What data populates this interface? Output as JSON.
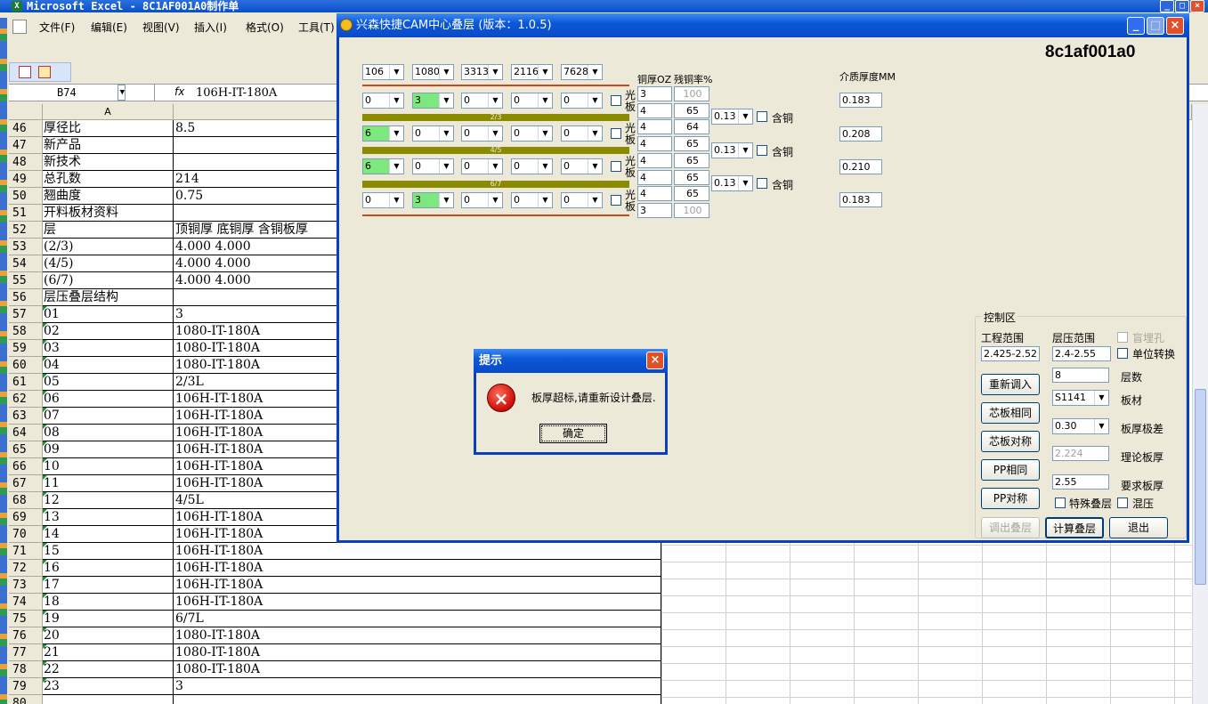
{
  "excel": {
    "title": "Microsoft Excel - 8C1AF001A0制作单",
    "menu": [
      "文件(F)",
      "编辑(E)",
      "视图(V)",
      "插入(I)",
      "格式(O)",
      "工具(T)"
    ],
    "name_box": "B74",
    "fx": "fx",
    "formula": "106H-IT-180A",
    "column_a": "A",
    "rows": [
      {
        "n": "46",
        "a": "厚径比",
        "b": "8.5"
      },
      {
        "n": "47",
        "a": "新产品",
        "b": ""
      },
      {
        "n": "48",
        "a": "新技术",
        "b": ""
      },
      {
        "n": "49",
        "a": "总孔数",
        "b": "214"
      },
      {
        "n": "50",
        "a": "翘曲度",
        "b": "0.75"
      },
      {
        "n": "51",
        "a": "开料板材资料",
        "b": ""
      },
      {
        "n": "52",
        "a": "层",
        "b": "顶铜厚  底铜厚  含铜板厚"
      },
      {
        "n": "53",
        "a": "(2/3)",
        "b": "4.000  4.000"
      },
      {
        "n": "54",
        "a": "(4/5)",
        "b": "4.000  4.000"
      },
      {
        "n": "55",
        "a": "(6/7)",
        "b": "4.000  4.000"
      },
      {
        "n": "56",
        "a": "层压叠层结构",
        "b": ""
      },
      {
        "n": "57",
        "a": "01",
        "b": "3"
      },
      {
        "n": "58",
        "a": "02",
        "b": "1080-IT-180A"
      },
      {
        "n": "59",
        "a": "03",
        "b": "1080-IT-180A"
      },
      {
        "n": "60",
        "a": "04",
        "b": "1080-IT-180A"
      },
      {
        "n": "61",
        "a": "05",
        "b": "2/3L"
      },
      {
        "n": "62",
        "a": "06",
        "b": "106H-IT-180A"
      },
      {
        "n": "63",
        "a": "07",
        "b": "106H-IT-180A"
      },
      {
        "n": "64",
        "a": "08",
        "b": "106H-IT-180A"
      },
      {
        "n": "65",
        "a": "09",
        "b": "106H-IT-180A"
      },
      {
        "n": "66",
        "a": "10",
        "b": "106H-IT-180A"
      },
      {
        "n": "67",
        "a": "11",
        "b": "106H-IT-180A"
      },
      {
        "n": "68",
        "a": "12",
        "b": "4/5L"
      },
      {
        "n": "69",
        "a": "13",
        "b": "106H-IT-180A"
      },
      {
        "n": "70",
        "a": "14",
        "b": "106H-IT-180A"
      },
      {
        "n": "71",
        "a": "15",
        "b": "106H-IT-180A"
      },
      {
        "n": "72",
        "a": "16",
        "b": "106H-IT-180A"
      },
      {
        "n": "73",
        "a": "17",
        "b": "106H-IT-180A"
      },
      {
        "n": "74",
        "a": "18",
        "b": "106H-IT-180A"
      },
      {
        "n": "75",
        "a": "19",
        "b": "6/7L"
      },
      {
        "n": "76",
        "a": "20",
        "b": "1080-IT-180A"
      },
      {
        "n": "77",
        "a": "21",
        "b": "1080-IT-180A"
      },
      {
        "n": "78",
        "a": "22",
        "b": "1080-IT-180A"
      },
      {
        "n": "79",
        "a": "23",
        "b": "3"
      },
      {
        "n": "80",
        "a": "",
        "b": ""
      }
    ]
  },
  "cam": {
    "title": "兴森快捷CAM中心叠层 (版本：1.0.5)",
    "job": "8c1af001a0",
    "prepreg_types": [
      "106",
      "1080",
      "3313",
      "2116",
      "7628"
    ],
    "col_cu_oz": "铜厚OZ",
    "col_residual": "残铜率%",
    "col_dielectric": "介质厚度MM",
    "guang_ban": "光板",
    "core_labels": [
      "2/3",
      "4/5",
      "6/7"
    ],
    "pp_rows": [
      [
        "0",
        "3",
        "0",
        "0",
        "0"
      ],
      [
        "6",
        "0",
        "0",
        "0",
        "0"
      ],
      [
        "6",
        "0",
        "0",
        "0",
        "0"
      ],
      [
        "0",
        "3",
        "0",
        "0",
        "0"
      ]
    ],
    "cu_oz": [
      "3",
      "4",
      "4",
      "4",
      "4",
      "4",
      "4",
      "3"
    ],
    "residual": [
      "100",
      "65",
      "64",
      "65",
      "65",
      "65",
      "65",
      "100"
    ],
    "core_thk": [
      "0.13",
      "0.13",
      "0.13"
    ],
    "han_tong": "含铜",
    "dielectric": [
      "0.183",
      "0.208",
      "0.210",
      "0.183"
    ],
    "control": {
      "legend": "控制区",
      "eng_range_label": "工程范围",
      "eng_range": "2.425-2.52",
      "lam_range_label": "层压范围",
      "lam_range": "2.4-2.55",
      "blind_buried": "盲埋孔",
      "unit_convert": "单位转换",
      "layers_value": "8",
      "layers_label": "层数",
      "material_value": "S1141",
      "material_label": "板材",
      "tol_value": "0.30",
      "tol_label": "板厚极差",
      "theory_value": "2.224",
      "theory_label": "理论板厚",
      "req_value": "2.55",
      "req_label": "要求板厚",
      "special": "特殊叠层",
      "mixed": "混压",
      "btn_reload": "重新调入",
      "btn_core_same": "芯板相同",
      "btn_core_sym": "芯板对称",
      "btn_pp_same": "PP相同",
      "btn_pp_sym": "PP对称",
      "btn_export": "调出叠层",
      "btn_calc": "计算叠层",
      "btn_exit": "退出"
    }
  },
  "dialog": {
    "title": "提示",
    "message": "板厚超标,请重新设计叠层.",
    "ok": "确定"
  }
}
